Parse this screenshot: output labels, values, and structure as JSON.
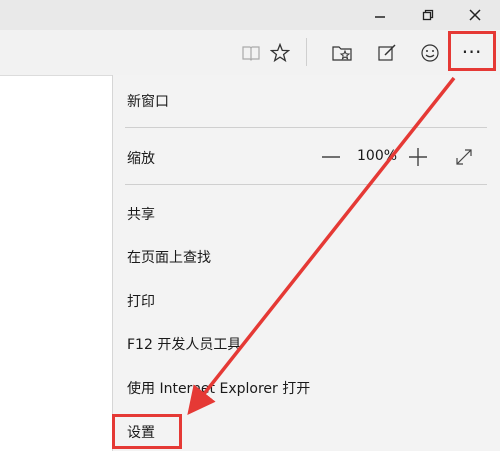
{
  "window": {
    "minimize_icon": "minimize-icon",
    "restore_icon": "restore-icon",
    "close_icon": "close-icon"
  },
  "toolbar": {
    "icons": [
      "reading-view-icon",
      "favorite-star-icon",
      "hub-icon",
      "web-note-icon",
      "feedback-smile-icon",
      "more-actions-icon"
    ],
    "more_label": "⋯"
  },
  "menu": {
    "new_window": "新窗口",
    "zoom_label": "缩放",
    "zoom_value": "100%",
    "share": "共享",
    "find_on_page": "在页面上查找",
    "print": "打印",
    "dev_tools": "F12 开发人员工具",
    "open_ie": "使用 Internet Explorer 打开",
    "settings": "设置"
  },
  "annotation": {
    "highlight_color": "#e53935"
  }
}
